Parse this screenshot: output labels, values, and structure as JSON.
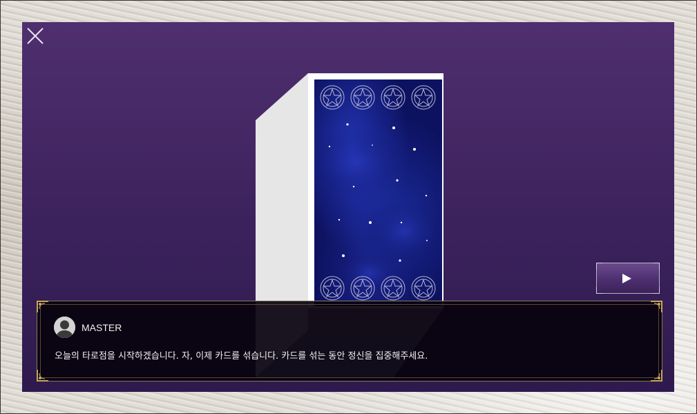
{
  "dialog": {
    "speaker": "MASTER",
    "message": "오늘의 타로점을 시작하겠습니다. 자, 이제 카드를 섞습니다. 카드를 섞는 동안 정신을 집중해주세요."
  },
  "icons": {
    "close": "close-icon",
    "next": "play-icon",
    "avatar": "user-silhouette-icon"
  },
  "colors": {
    "stage_top": "#4f2f6e",
    "stage_bottom": "#2e1a4d",
    "card_back": "#0d1260",
    "dialog_bg": "#08020e",
    "gold_ornament": "#c9a85a"
  }
}
